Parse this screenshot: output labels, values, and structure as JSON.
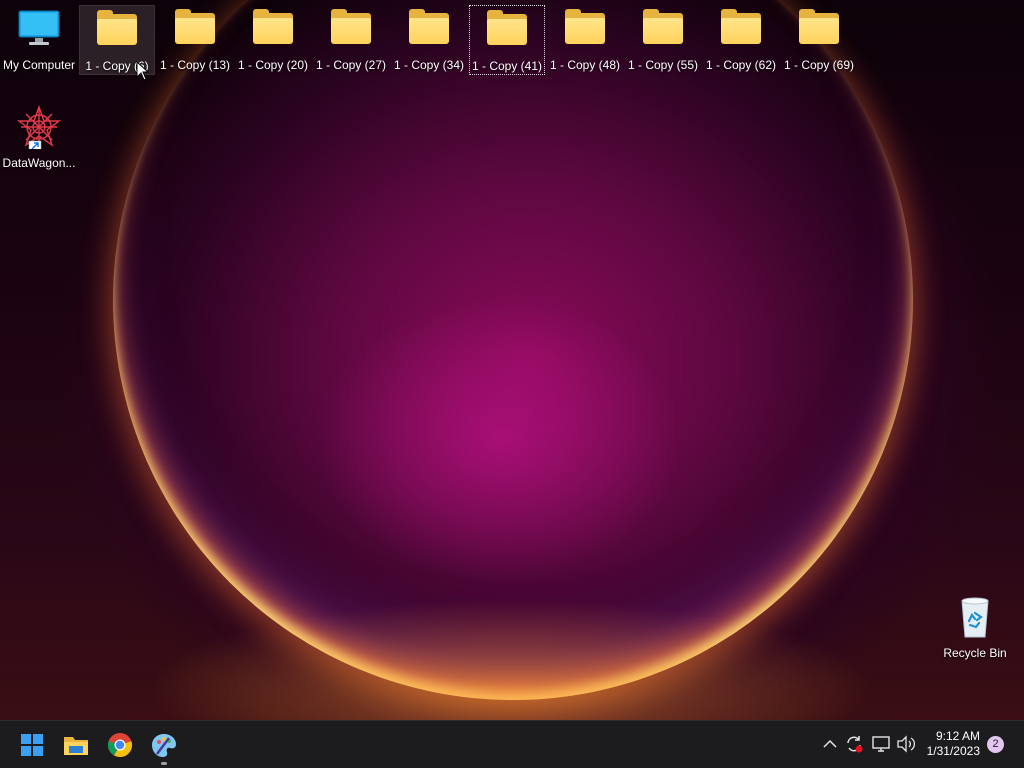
{
  "desktop": {
    "icons": [
      {
        "label": "My Computer",
        "icon": "monitor-icon"
      },
      {
        "label": "1 - Copy (6)",
        "icon": "folder-icon"
      },
      {
        "label": "1 - Copy (13)",
        "icon": "folder-icon"
      },
      {
        "label": "1 - Copy (20)",
        "icon": "folder-icon"
      },
      {
        "label": "1 - Copy (27)",
        "icon": "folder-icon"
      },
      {
        "label": "1 - Copy (34)",
        "icon": "folder-icon"
      },
      {
        "label": "1 - Copy (41)",
        "icon": "folder-icon"
      },
      {
        "label": "1 - Copy (48)",
        "icon": "folder-icon"
      },
      {
        "label": "1 - Copy (55)",
        "icon": "folder-icon"
      },
      {
        "label": "1 - Copy (62)",
        "icon": "folder-icon"
      },
      {
        "label": "1 - Copy (69)",
        "icon": "folder-icon"
      },
      {
        "label": "DataWagon...",
        "icon": "datawagon-shortcut-icon"
      },
      {
        "label": "Recycle Bin",
        "icon": "recycle-bin-icon"
      }
    ]
  },
  "taskbar": {
    "pinned": [
      {
        "name": "start",
        "icon": "windows-start-icon"
      },
      {
        "name": "file-explorer",
        "icon": "file-explorer-icon"
      },
      {
        "name": "chrome",
        "icon": "chrome-icon"
      },
      {
        "name": "paint",
        "icon": "paint-icon"
      }
    ],
    "tray": {
      "icons": [
        "chevron-up-icon",
        "sync-icon",
        "network-icon",
        "volume-icon"
      ],
      "time": "9:12 AM",
      "date": "1/31/2023",
      "notification_count": "2"
    }
  },
  "colors": {
    "taskbar_bg": "#1c1c1f",
    "folder": "#ffd35c",
    "accent": "#0078d4"
  }
}
